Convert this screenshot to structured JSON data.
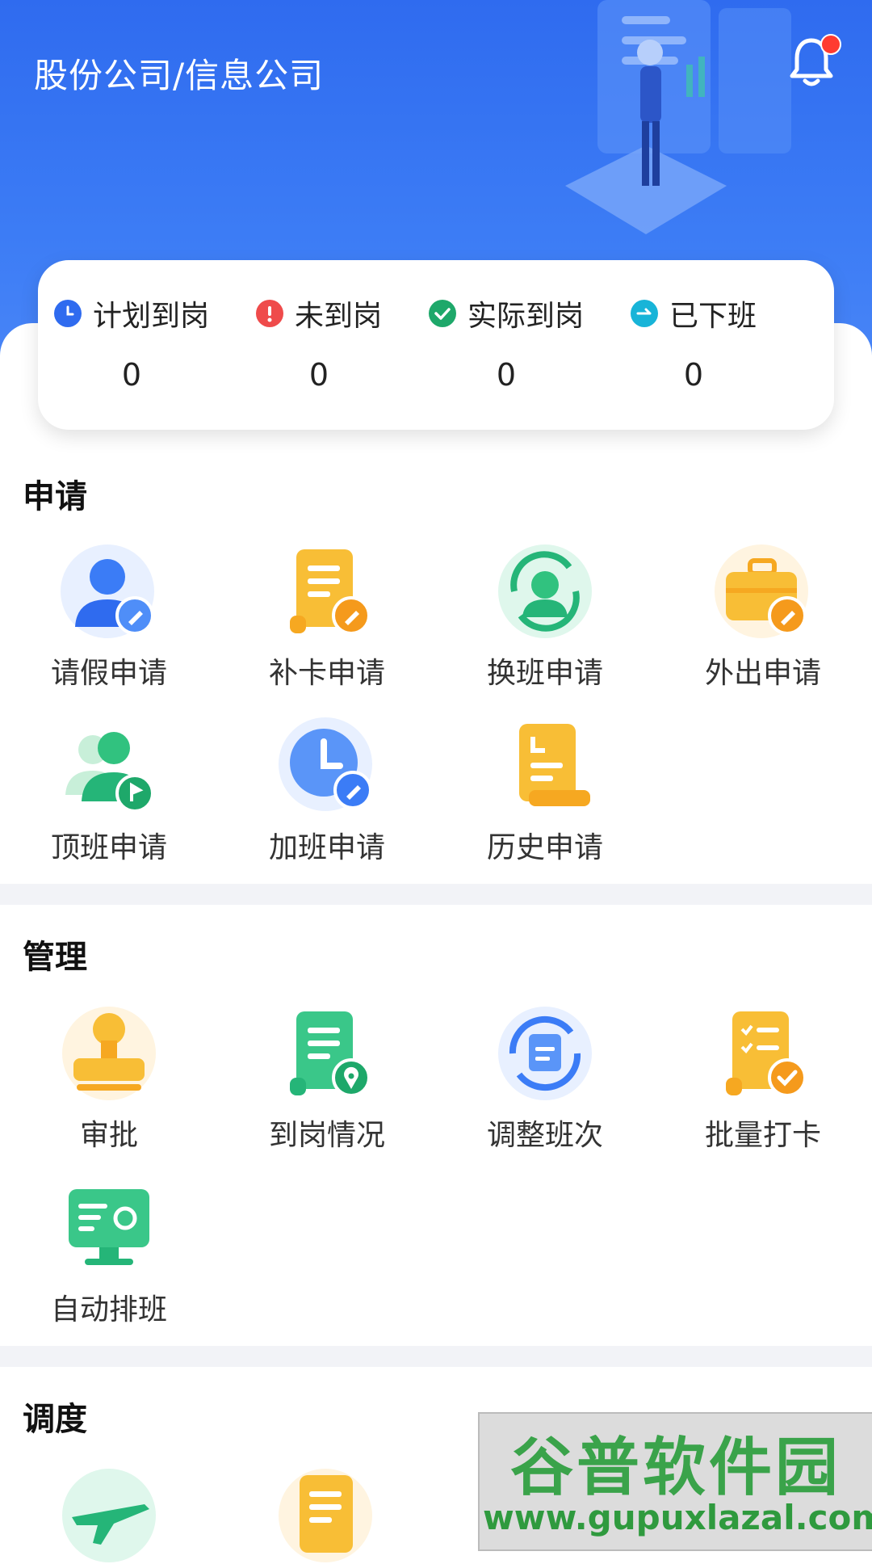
{
  "header": {
    "org_name": "股份公司/信息公司"
  },
  "stats": [
    {
      "label": "计划到岗",
      "value": "0",
      "color": "#2f6bef"
    },
    {
      "label": "未到岗",
      "value": "0",
      "color": "#ef4b4b"
    },
    {
      "label": "实际到岗",
      "value": "0",
      "color": "#1ea86a"
    },
    {
      "label": "已下班",
      "value": "0",
      "color": "#18b4d8"
    }
  ],
  "sections": {
    "apply": {
      "title": "申请",
      "items": [
        "请假申请",
        "补卡申请",
        "换班申请",
        "外出申请",
        "顶班申请",
        "加班申请",
        "历史申请"
      ]
    },
    "manage": {
      "title": "管理",
      "items": [
        "审批",
        "到岗情况",
        "调整班次",
        "批量打卡",
        "自动排班"
      ]
    },
    "dispatch": {
      "title": "调度"
    }
  },
  "watermark": {
    "title": "谷普软件园",
    "url": "www.gupuxlazal.com"
  }
}
